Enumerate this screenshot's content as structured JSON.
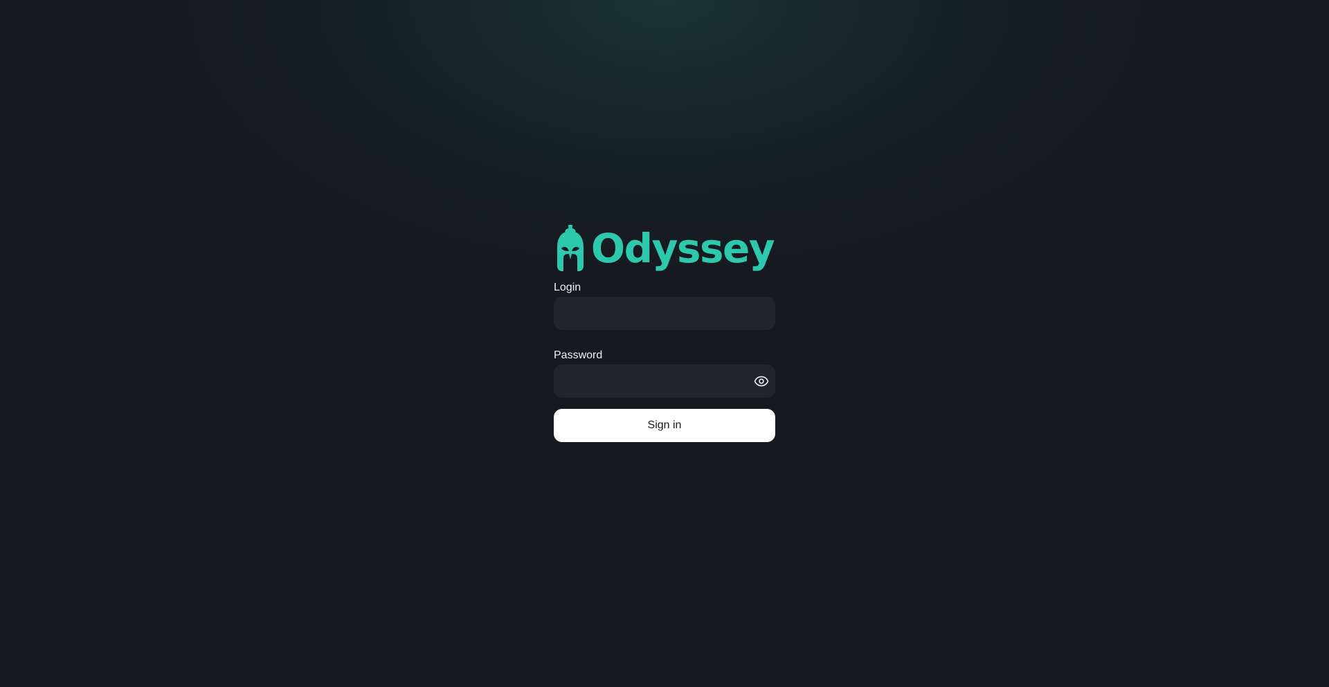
{
  "brand": {
    "name": "Odyssey",
    "logo_icon": "spartan-helmet-icon",
    "accent_color": "#2ec9ad"
  },
  "form": {
    "login_label": "Login",
    "login_value": "",
    "login_placeholder": "",
    "password_label": "Password",
    "password_value": "",
    "password_placeholder": "",
    "password_toggle_icon": "eye-icon",
    "signin_label": "Sign in"
  }
}
